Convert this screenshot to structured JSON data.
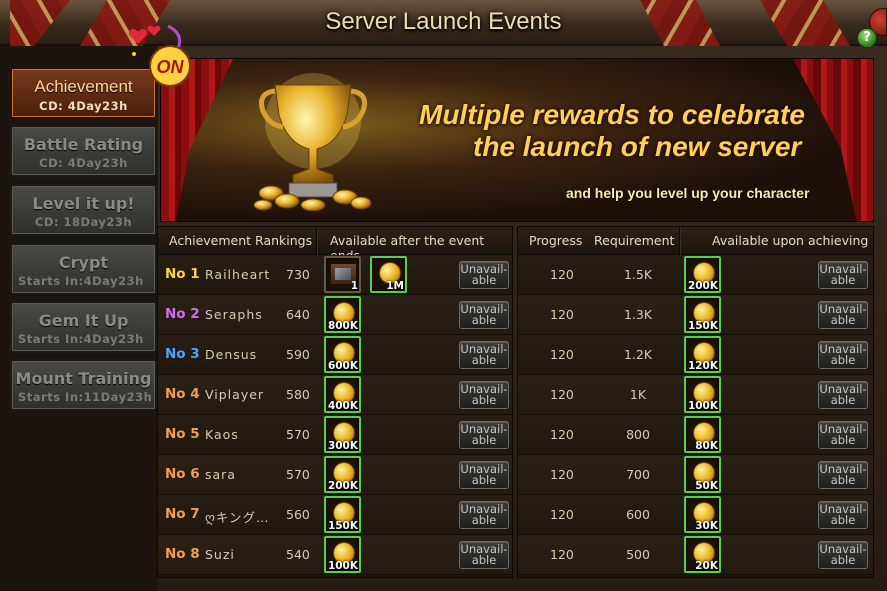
{
  "window": {
    "title": "Server Launch Events"
  },
  "sidebar": {
    "items": [
      {
        "name": "Achievement",
        "sub": "CD:  4Day23h",
        "active": true
      },
      {
        "name": "Battle Rating",
        "sub": "CD:  4Day23h",
        "active": false
      },
      {
        "name": "Level it up!",
        "sub": "CD: 18Day23h",
        "active": false
      },
      {
        "name": "Crypt",
        "sub": "Starts In:4Day23h",
        "active": false
      },
      {
        "name": "Gem It Up",
        "sub": "Starts In:4Day23h",
        "active": false
      },
      {
        "name": "Mount Training",
        "sub": "Starts In:11Day23h",
        "active": false
      }
    ]
  },
  "banner": {
    "badge": "ON",
    "line1": "Multiple rewards to celebrate",
    "line2": "the launch of new server",
    "line3": "and help you level up your character"
  },
  "rankings_table": {
    "headers": {
      "rankings": "Achievement Rankings",
      "rewards": "Available after the event ends"
    },
    "rows": [
      {
        "rank": "No 1",
        "rank_color": "#ffd24a",
        "name": "Railheart",
        "score": "730",
        "reward_extra_qty": "1",
        "reward_qty": "1M",
        "button": "Unavail-able"
      },
      {
        "rank": "No 2",
        "rank_color": "#d070f0",
        "name": "Seraphs",
        "score": "640",
        "reward_qty": "800K",
        "button": "Unavail-able"
      },
      {
        "rank": "No 3",
        "rank_color": "#4aa8ff",
        "name": "Densus",
        "score": "590",
        "reward_qty": "600K",
        "button": "Unavail-able"
      },
      {
        "rank": "No 4",
        "rank_color": "#f0a050",
        "name": "Viplayer",
        "score": "580",
        "reward_qty": "400K",
        "button": "Unavail-able"
      },
      {
        "rank": "No 5",
        "rank_color": "#f0a050",
        "name": "Kaos",
        "score": "570",
        "reward_qty": "300K",
        "button": "Unavail-able"
      },
      {
        "rank": "No 6",
        "rank_color": "#f0a050",
        "name": "sara",
        "score": "570",
        "reward_qty": "200K",
        "button": "Unavail-able"
      },
      {
        "rank": "No 7",
        "rank_color": "#f0a050",
        "name": "ღキング…",
        "score": "560",
        "reward_qty": "150K",
        "button": "Unavail-able"
      },
      {
        "rank": "No 8",
        "rank_color": "#f0a050",
        "name": "Suzi",
        "score": "540",
        "reward_qty": "100K",
        "button": "Unavail-able"
      }
    ]
  },
  "requirements_table": {
    "headers": {
      "progress": "Progress",
      "requirement": "Requirement",
      "rewards": "Available upon achieving"
    },
    "rows": [
      {
        "progress": "120",
        "requirement": "1.5K",
        "reward_qty": "200K",
        "button": "Unavail-able"
      },
      {
        "progress": "120",
        "requirement": "1.3K",
        "reward_qty": "150K",
        "button": "Unavail-able"
      },
      {
        "progress": "120",
        "requirement": "1.2K",
        "reward_qty": "120K",
        "button": "Unavail-able"
      },
      {
        "progress": "120",
        "requirement": "1K",
        "reward_qty": "100K",
        "button": "Unavail-able"
      },
      {
        "progress": "120",
        "requirement": "800",
        "reward_qty": "80K",
        "button": "Unavail-able"
      },
      {
        "progress": "120",
        "requirement": "700",
        "reward_qty": "50K",
        "button": "Unavail-able"
      },
      {
        "progress": "120",
        "requirement": "600",
        "reward_qty": "30K",
        "button": "Unavail-able"
      },
      {
        "progress": "120",
        "requirement": "500",
        "reward_qty": "20K",
        "button": "Unavail-able"
      }
    ]
  },
  "icons": {
    "close": "close-icon",
    "help": "help-icon",
    "coin": "gold-coin-icon",
    "chest": "treasure-chest-icon",
    "trophy": "trophy-icon"
  }
}
